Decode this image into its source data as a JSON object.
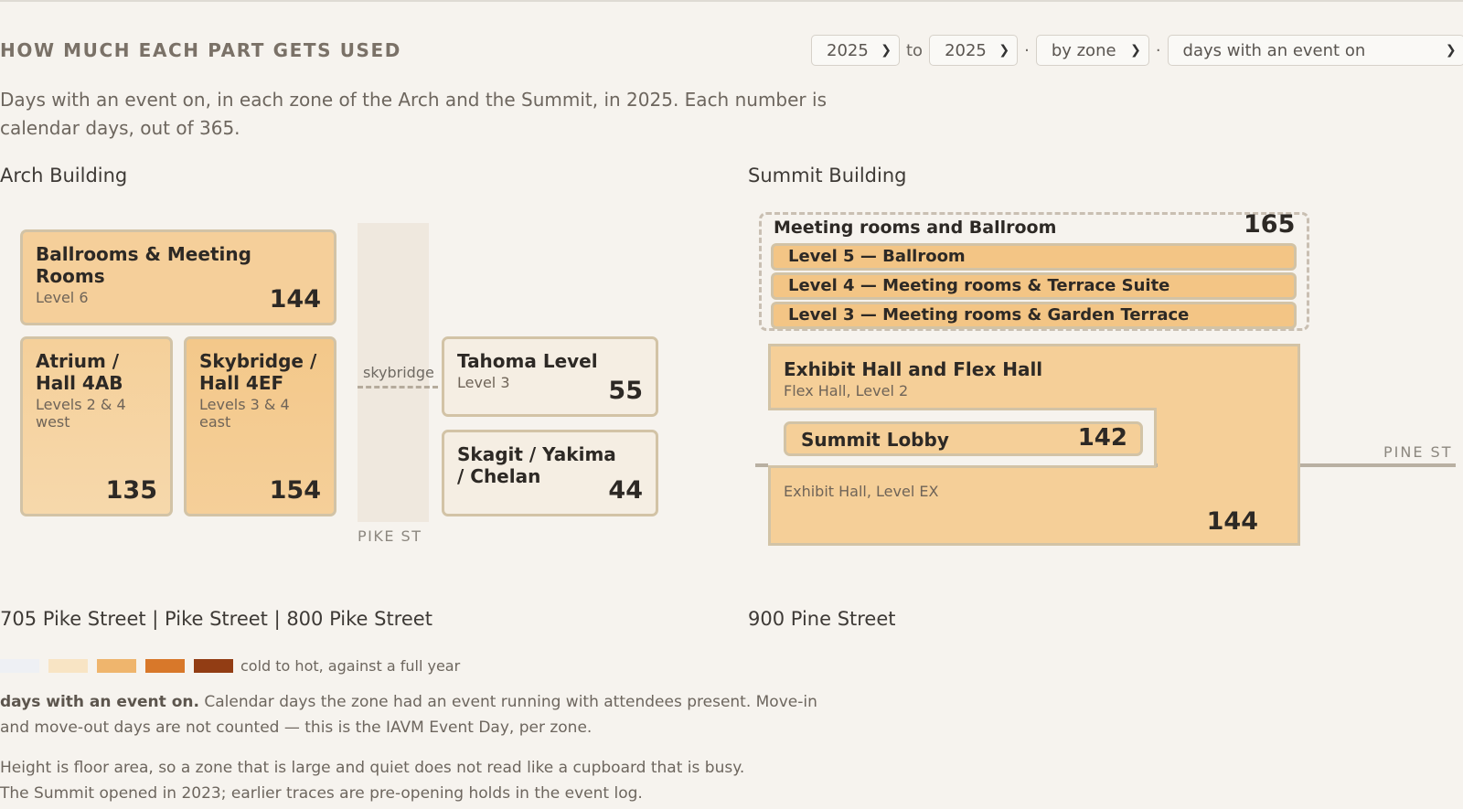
{
  "header": {
    "title": "HOW MUCH EACH PART GETS USED",
    "from_year": "2025",
    "to_label": "to",
    "to_year": "2025",
    "sep": "·",
    "grouping": "by zone",
    "metric": "days with an event on"
  },
  "description": "Days with an event on, in each zone of the Arch and the Summit, in 2025. Each number is calendar days, out of 365.",
  "arch": {
    "heading": "Arch Building",
    "zones": [
      {
        "name": "Ballrooms & Meeting Rooms",
        "sub": "Level 6",
        "value": "144"
      },
      {
        "name": "Atrium / Hall 4AB",
        "sub": "Levels 2 & 4 west",
        "value": "135"
      },
      {
        "name": "Skybridge / Hall 4EF",
        "sub": "Levels 3 & 4 east",
        "value": "154"
      },
      {
        "name": "Tahoma Level",
        "sub": "Level 3",
        "value": "55"
      },
      {
        "name": "Skagit / Yakima / Chelan",
        "sub": "",
        "value": "44"
      }
    ],
    "skybridge_label": "skybridge",
    "street_label": "PIKE ST",
    "address": "705 Pike Street | Pike Street | 800 Pike Street"
  },
  "summit": {
    "heading": "Summit Building",
    "meeting": {
      "name": "Meeting rooms and Ballroom",
      "value": "165",
      "levels": [
        "Level 5 — Ballroom",
        "Level 4 — Meeting rooms & Terrace Suite",
        "Level 3 — Meeting rooms & Garden Terrace"
      ]
    },
    "exhibit": {
      "name": "Exhibit Hall and Flex Hall",
      "sub": "Flex Hall, Level 2",
      "sub2": "Exhibit Hall, Level EX",
      "value": "144"
    },
    "lobby": {
      "name": "Summit Lobby",
      "value": "142"
    },
    "street_label": "PINE ST",
    "address": "900 Pine Street"
  },
  "legend": {
    "swatches": [
      "#eef0f4",
      "#f8e4c4",
      "#efb56d",
      "#d8782a",
      "#923d14"
    ],
    "label": "cold to hot, against a full year"
  },
  "notes": {
    "metric_name": "days with an event on.",
    "metric_text": "Calendar days the zone had an event running with attendees present. Move-in and move-out days are not counted — this is the IAVM Event Day, per zone.",
    "line1": "Height is floor area, so a zone that is large and quiet does not read like a cupboard that is busy.",
    "line2": "The Summit opened in 2023; earlier traces are pre-opening holds in the event log."
  }
}
